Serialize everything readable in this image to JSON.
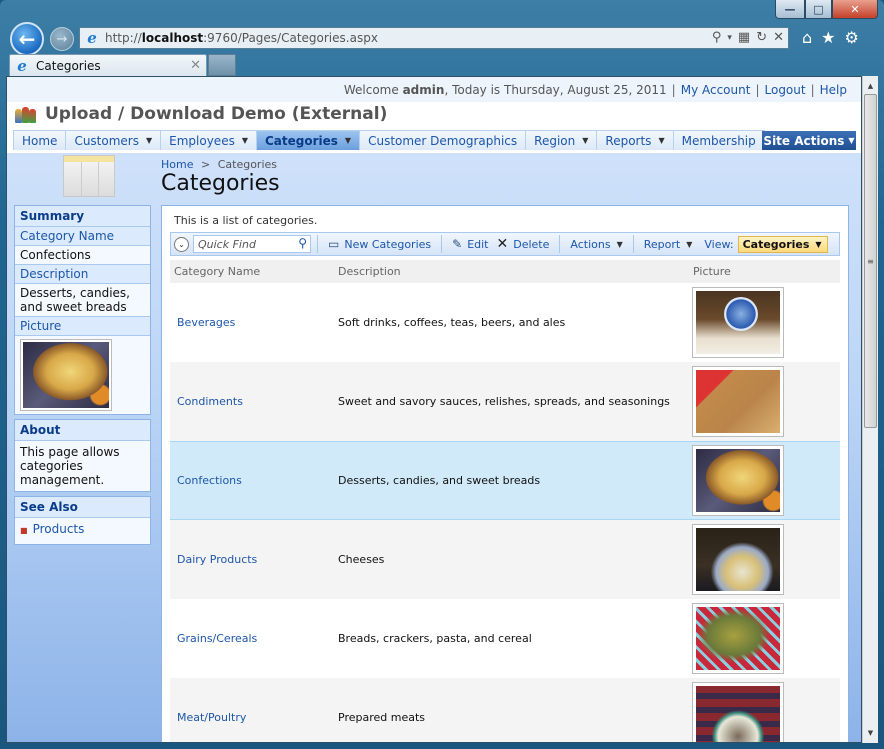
{
  "browser": {
    "address_prefix": "http://",
    "address_host": "localhost",
    "address_rest": ":9760/Pages/Categories.aspx",
    "tab_title": "Categories",
    "window_controls": {
      "minimize": "—",
      "maximize": "□",
      "close": "✕"
    },
    "icons": {
      "back": "←",
      "forward": "→",
      "search": "⚲",
      "dropdown": "▾",
      "compat": "▦",
      "refresh": "↻",
      "stop": "✕",
      "home": "⌂",
      "favorites": "★",
      "tools": "⚙",
      "tab_close": "✕",
      "ie": "e"
    }
  },
  "topbar": {
    "welcome_prefix": "Welcome ",
    "user": "admin",
    "date_text": ", Today is Thursday, August 25, 2011",
    "links": [
      "My Account",
      "Logout",
      "Help"
    ]
  },
  "app": {
    "title": "Upload / Download Demo (External)"
  },
  "menu": {
    "items": [
      {
        "label": "Home",
        "has_dropdown": false
      },
      {
        "label": "Customers",
        "has_dropdown": true
      },
      {
        "label": "Employees",
        "has_dropdown": true
      },
      {
        "label": "Categories",
        "has_dropdown": true,
        "active": true
      },
      {
        "label": "Customer Demographics",
        "has_dropdown": false
      },
      {
        "label": "Region",
        "has_dropdown": true
      },
      {
        "label": "Reports",
        "has_dropdown": true
      },
      {
        "label": "Membership",
        "has_dropdown": false
      }
    ],
    "site_actions": "Site Actions",
    "arrow": "▼"
  },
  "breadcrumb": {
    "home": "Home",
    "separator": ">",
    "current": "Categories"
  },
  "page": {
    "title": "Categories",
    "description": "This is a list of categories."
  },
  "sidebar": {
    "summary": {
      "title": "Summary",
      "fields": [
        {
          "label": "Category Name",
          "value": "Confections"
        },
        {
          "label": "Description",
          "value": "Desserts, candies, and sweet breads"
        },
        {
          "label": "Picture",
          "value": ""
        }
      ]
    },
    "about": {
      "title": "About",
      "text": "This page allows categories management."
    },
    "see_also": {
      "title": "See Also",
      "links": [
        "Products"
      ],
      "bullet": "■"
    }
  },
  "toolbar": {
    "collapse_icon": "⌄",
    "quick_find_placeholder": "Quick Find",
    "search_icon": "⚲",
    "new_label": "New Categories",
    "new_icon": "▭",
    "edit_label": "Edit",
    "edit_icon": "✎",
    "delete_label": "Delete",
    "delete_icon": "✕",
    "actions_label": "Actions",
    "report_label": "Report",
    "view_label": "View:",
    "view_value": "Categories",
    "arrow": "▼"
  },
  "grid": {
    "columns": [
      "Category Name",
      "Description",
      "Picture"
    ],
    "rows": [
      {
        "name": "Beverages",
        "description": "Soft drinks, coffees, teas, beers, and ales",
        "picture": "beverages"
      },
      {
        "name": "Condiments",
        "description": "Sweet and savory sauces, relishes, spreads, and seasonings",
        "picture": "condiments"
      },
      {
        "name": "Confections",
        "description": "Desserts, candies, and sweet breads",
        "picture": "confections",
        "selected": true
      },
      {
        "name": "Dairy Products",
        "description": "Cheeses",
        "picture": "dairy"
      },
      {
        "name": "Grains/Cereals",
        "description": "Breads, crackers, pasta, and cereal",
        "picture": "grains"
      },
      {
        "name": "Meat/Poultry",
        "description": "Prepared meats",
        "picture": "meat"
      }
    ]
  },
  "scrollbar": {
    "up": "▲",
    "down": "▼",
    "grip": "≡"
  }
}
